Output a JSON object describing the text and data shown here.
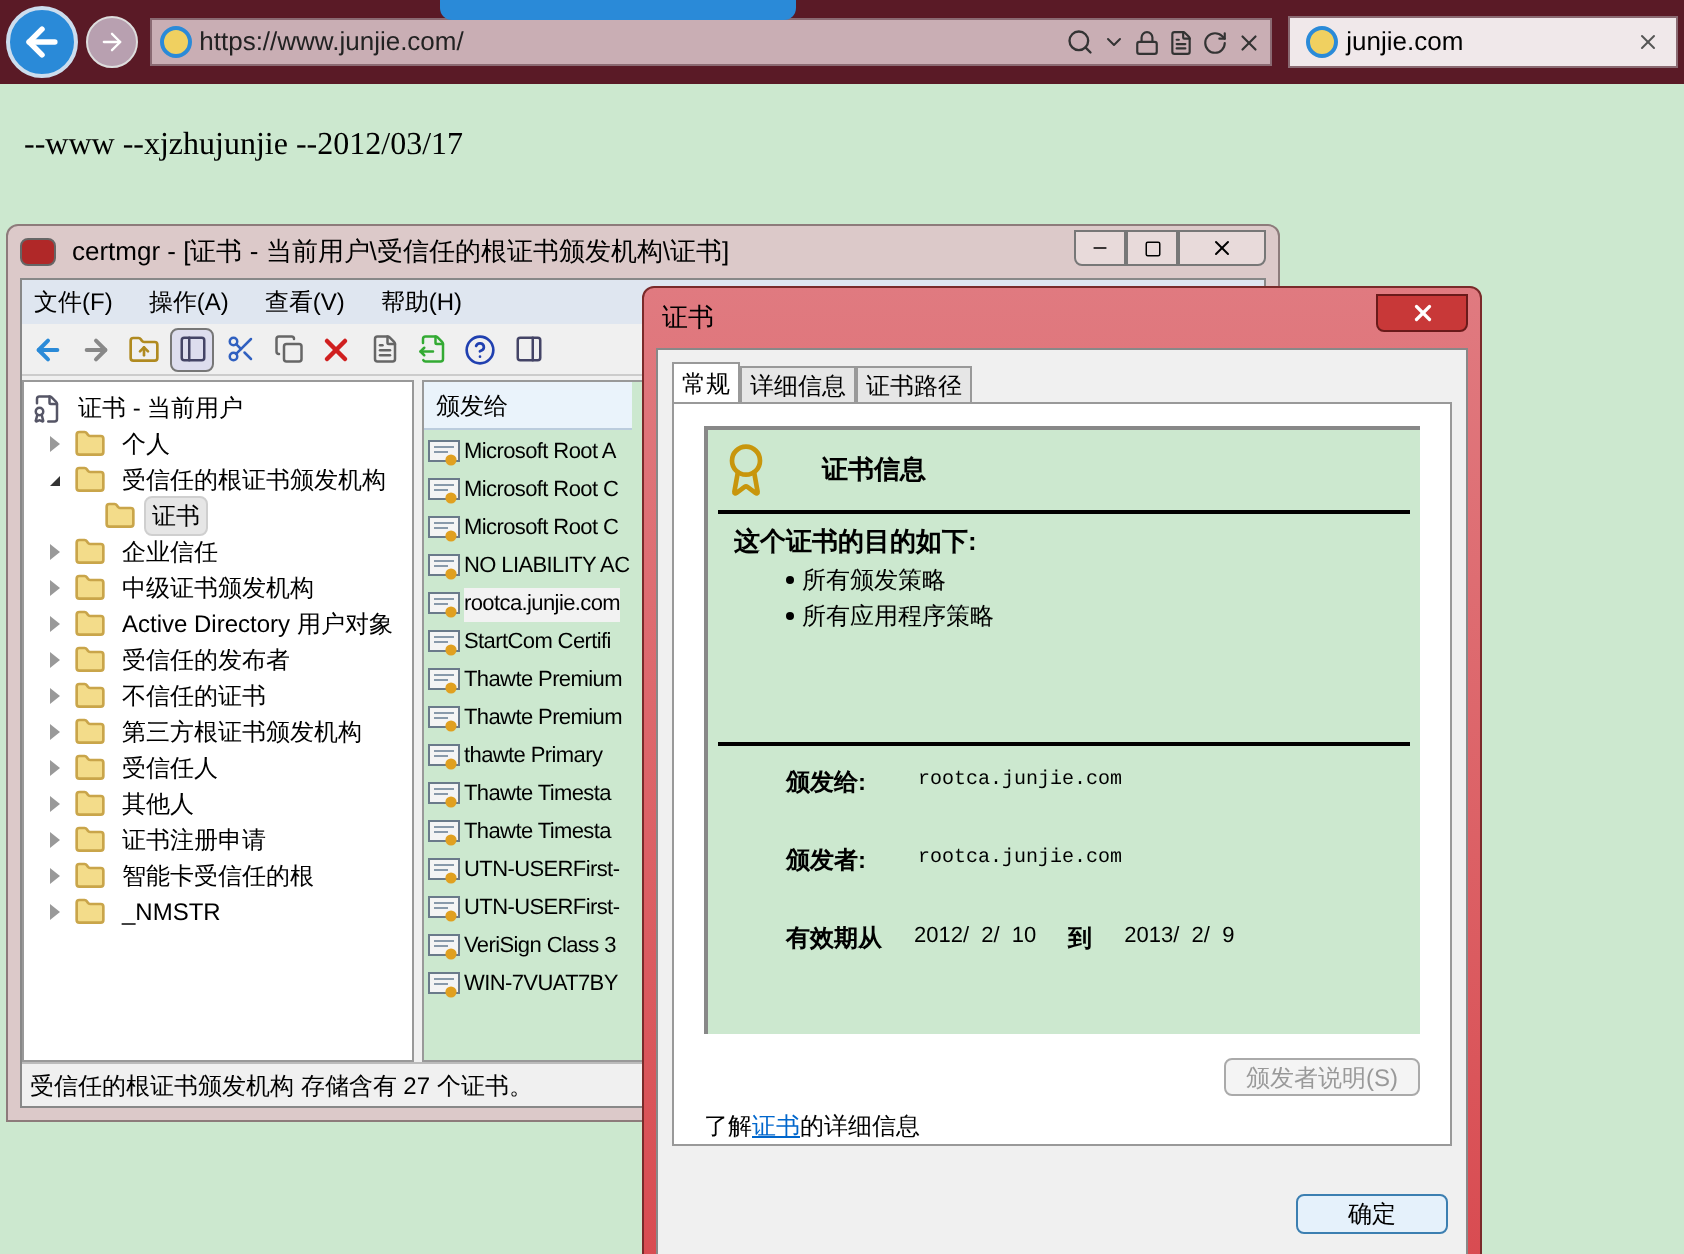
{
  "browser": {
    "address": "https://www.junjie.com/",
    "tab": {
      "title": "junjie.com",
      "selected": true
    }
  },
  "page": {
    "text": "--www --xjzhujunjie --2012/03/17"
  },
  "certmgr": {
    "title": "certmgr - [证书 - 当前用户\\受信任的根证书颁发机构\\证书]",
    "menu": [
      "文件(F)",
      "操作(A)",
      "查看(V)",
      "帮助(H)"
    ],
    "tree": [
      {
        "label": "证书 - 当前用户",
        "kind": "root",
        "selected": false,
        "children": [
          {
            "label": "个人",
            "kind": "folder",
            "expanded": false,
            "selected": false
          },
          {
            "label": "受信任的根证书颁发机构",
            "kind": "folder",
            "expanded": true,
            "selected": false,
            "children": [
              {
                "label": "证书",
                "kind": "folder",
                "selected": true
              }
            ]
          },
          {
            "label": "企业信任",
            "kind": "folder",
            "expanded": false,
            "selected": false
          },
          {
            "label": "中级证书颁发机构",
            "kind": "folder",
            "expanded": false,
            "selected": false
          },
          {
            "label": "Active Directory 用户对象",
            "kind": "folder",
            "expanded": false,
            "selected": false
          },
          {
            "label": "受信任的发布者",
            "kind": "folder",
            "expanded": false,
            "selected": false
          },
          {
            "label": "不信任的证书",
            "kind": "folder",
            "expanded": false,
            "selected": false
          },
          {
            "label": "第三方根证书颁发机构",
            "kind": "folder",
            "expanded": false,
            "selected": false
          },
          {
            "label": "受信任人",
            "kind": "folder",
            "expanded": false,
            "selected": false
          },
          {
            "label": "其他人",
            "kind": "folder",
            "expanded": false,
            "selected": false
          },
          {
            "label": "证书注册申请",
            "kind": "folder",
            "expanded": false,
            "selected": false
          },
          {
            "label": "智能卡受信任的根",
            "kind": "folder",
            "expanded": false,
            "selected": false
          },
          {
            "label": "_NMSTR",
            "kind": "folder",
            "expanded": false,
            "selected": false
          }
        ]
      }
    ],
    "list": {
      "column": "颁发给",
      "rows": [
        {
          "label": "Microsoft Root A",
          "selected": false
        },
        {
          "label": "Microsoft Root C",
          "selected": false
        },
        {
          "label": "Microsoft Root C",
          "selected": false
        },
        {
          "label": "NO LIABILITY AC",
          "selected": false
        },
        {
          "label": "rootca.junjie.com",
          "selected": true
        },
        {
          "label": "StartCom Certifi",
          "selected": false
        },
        {
          "label": "Thawte Premium",
          "selected": false
        },
        {
          "label": "Thawte Premium",
          "selected": false
        },
        {
          "label": "thawte Primary",
          "selected": false
        },
        {
          "label": "Thawte Timesta",
          "selected": false
        },
        {
          "label": "Thawte Timesta",
          "selected": false
        },
        {
          "label": "UTN-USERFirst-",
          "selected": false
        },
        {
          "label": "UTN-USERFirst-",
          "selected": false
        },
        {
          "label": "VeriSign Class 3",
          "selected": false
        },
        {
          "label": "WIN-7VUAT7BY",
          "selected": false
        }
      ]
    },
    "status_bar": "受信任的根证书颁发机构 存储含有 27 个证书。"
  },
  "dialog": {
    "title": "证书",
    "tabs": [
      {
        "label": "常规",
        "selected": true
      },
      {
        "label": "详细信息",
        "selected": false
      },
      {
        "label": "证书路径",
        "selected": false
      }
    ],
    "heading": "证书信息",
    "purpose_title": "这个证书的目的如下:",
    "purposes": [
      "所有颁发策略",
      "所有应用程序策略"
    ],
    "issued_to": {
      "label": "颁发给:",
      "value": "rootca.junjie.com"
    },
    "issued_by": {
      "label": "颁发者:",
      "value": "rootca.junjie.com"
    },
    "validity": {
      "label": "有效期从",
      "from": "2012/  2/  10",
      "to_label": "到",
      "to": "2013/  2/  9"
    },
    "issuer_statement": {
      "label": "颁发者说明(S)",
      "disabled": true
    },
    "learn_more": {
      "before": "了解",
      "link": "证书",
      "after": "的详细信息"
    },
    "ok": "确定"
  }
}
